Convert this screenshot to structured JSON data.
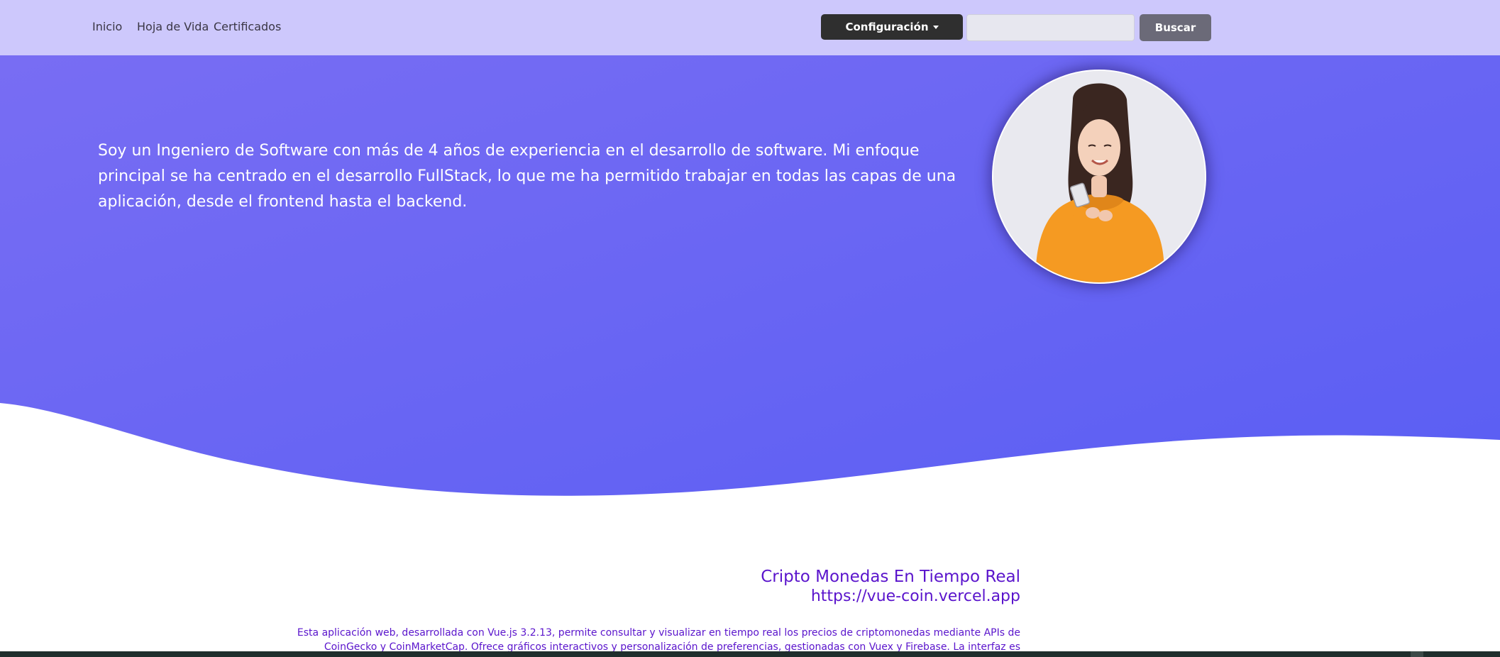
{
  "navbar": {
    "links": [
      "Inicio",
      "Hoja de Vida",
      "Certificados"
    ],
    "config_label": "Configuración",
    "search": {
      "value": "",
      "placeholder": ""
    },
    "search_button_label": "Buscar"
  },
  "hero": {
    "text": "Soy un Ingeniero de Software con más de 4 años de experiencia en el desarrollo de software. Mi enfoque principal se ha centrado en el desarrollo FullStack, lo que me ha permitido trabajar en todas las capas de una aplicación, desde el frontend hasta el backend.",
    "avatar_icon": "person-with-phone-photo"
  },
  "project": {
    "title": "Cripto Monedas En Tiempo Real",
    "url": "https://vue-coin.vercel.app",
    "description": "Esta aplicación web, desarrollada con Vue.js 3.2.13, permite consultar y visualizar en tiempo real los precios de criptomonedas mediante APIs de CoinGecko y CoinMarketCap. Ofrece gráficos interactivos y personalización de preferencias, gestionadas con Vuex y Firebase. La interfaz es"
  },
  "colors": {
    "navbar_bg": "#cdc8fc",
    "hero_gradient_start": "#7a6ef3",
    "hero_gradient_end": "#5a5ef3",
    "accent_text": "#5a14cc",
    "config_button_bg": "#2f2f2f",
    "search_button_bg": "#6b6a78"
  }
}
